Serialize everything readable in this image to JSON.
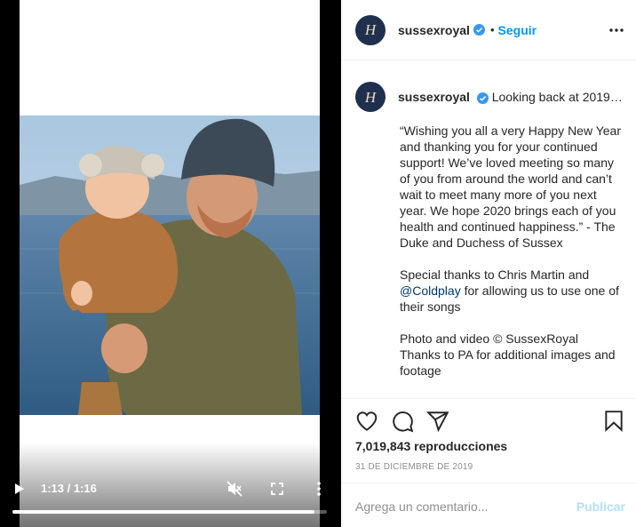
{
  "post": {
    "username": "sussexroyal",
    "follow_label": "Seguir",
    "separator": "•",
    "avatar_letter": "H"
  },
  "video": {
    "time": "1:13 / 1:16",
    "progress": 0.96
  },
  "caption": {
    "username": "sussexroyal",
    "headline": "Looking back at 2019…",
    "paragraph1": "“Wishing you all a very Happy New Year and thanking you for your continued support! We’ve loved meeting so many of you from around the world and can’t wait to meet many more of you next year. We hope 2020 brings each of you health and continued happiness.” - The Duke and Duchess of Sussex",
    "paragraph2_before": "Special thanks to Chris Martin and ",
    "mention": "@Coldplay",
    "paragraph2_after": " for allowing us to use one of their songs",
    "paragraph3_line1": "Photo and video © SussexRoyal",
    "paragraph3_line2": "Thanks to PA for additional images and footage"
  },
  "stats": {
    "views": "7,019,843 reproducciones",
    "date": "31 DE DICIEMBRE DE 2019"
  },
  "comment": {
    "placeholder": "Agrega un comentario...",
    "publish_label": "Publicar"
  },
  "icons": {
    "play": "play-icon",
    "mute": "muted-speaker-icon",
    "fullscreen": "fullscreen-icon",
    "more": "vertical-dots-icon",
    "like": "heart-icon",
    "comment": "speech-bubble-icon",
    "share": "paper-plane-icon",
    "save": "bookmark-icon",
    "verified": "verified-badge-icon"
  },
  "colors": {
    "accent": "#0095f6",
    "verified": "#3897f0",
    "publish_disabled": "#b2dffc",
    "mention": "#00376b"
  }
}
